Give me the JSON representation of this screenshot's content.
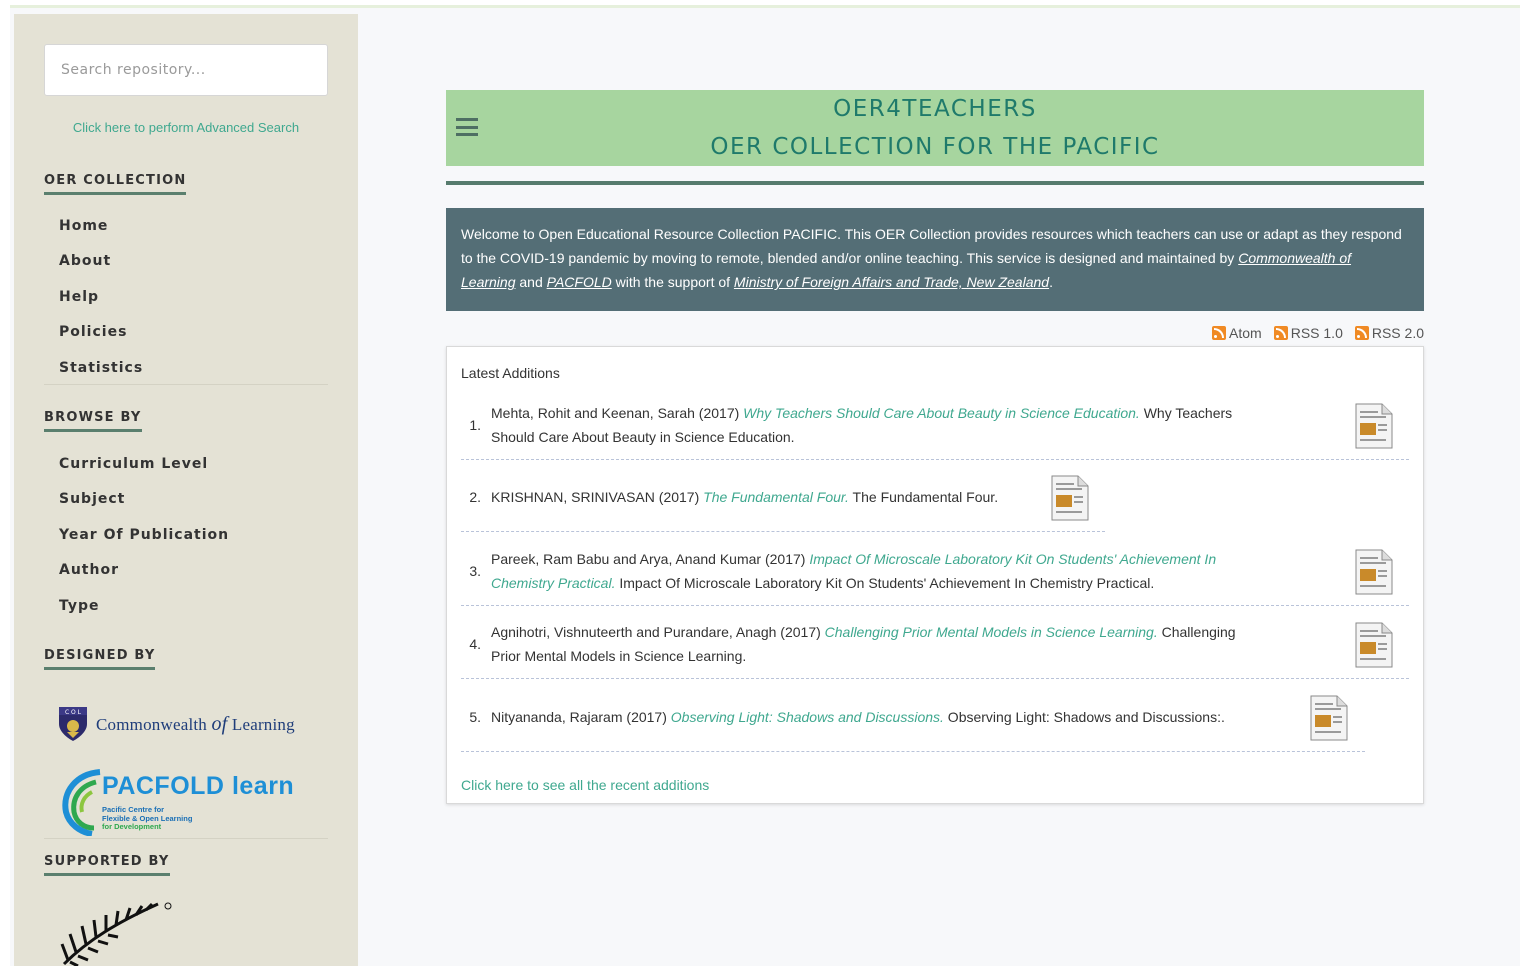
{
  "sidebar": {
    "search_placeholder": "Search repository...",
    "advanced_search_link": "Click here to perform Advanced Search",
    "sections": [
      {
        "heading": "OER COLLECTION",
        "items": [
          "Home",
          "About",
          "Help",
          "Policies",
          "Statistics"
        ]
      },
      {
        "heading": "BROWSE BY",
        "items": [
          "Curriculum Level",
          "Subject",
          "Year Of Publication",
          "Author",
          "Type"
        ]
      },
      {
        "heading": "DESIGNED BY"
      },
      {
        "heading": "SUPPORTED BY"
      }
    ],
    "logos": {
      "col_prefix": "Commonwealth ",
      "col_of": "of",
      "col_suffix": " Learning",
      "pacfold_main": "PACFOLD",
      "pacfold_learn": "learn",
      "pacfold_sub1": "Pacific Centre for",
      "pacfold_sub2": "Flexible & Open Learning",
      "pacfold_sub3": "for Development"
    }
  },
  "banner": {
    "title_line1": "OER4TEACHERS",
    "title_line2": "OER COLLECTION FOR THE PACIFIC"
  },
  "welcome": {
    "text_before": "Welcome to Open Educational Resource Collection PACIFIC. This OER Collection provides resources which teachers can use or adapt as they respond to the COVID-19 pandemic by moving to remote, blended and/or online teaching. This service is designed and maintained by ",
    "link_col": "Commonwealth of Learning",
    "and": " and ",
    "link_pacfold": "PACFOLD",
    "with_support": " with the support of ",
    "link_mfat": "Ministry of Foreign Affairs and Trade, New Zealand",
    "period": "."
  },
  "feeds": [
    "Atom",
    "RSS 1.0",
    "RSS 2.0"
  ],
  "latest": {
    "heading": "Latest Additions",
    "items": [
      {
        "num": "1.",
        "authors_before": "Mehta, Rohit",
        "and": " and ",
        "authors_after": "Keenan, Sarah",
        "year": " (2017) ",
        "title": "Why Teachers Should Care About Beauty in Science Education.",
        "desc_line1": " Why Teachers",
        "desc_line2": "Should Care About Beauty in Science Education."
      },
      {
        "num": "2.",
        "authors_before": "KRISHNAN, SRINIVASAN",
        "year": " (2017) ",
        "title": "The Fundamental Four.",
        "desc_line1": " The Fundamental Four."
      },
      {
        "num": "3.",
        "authors_before": "Pareek, Ram Babu",
        "and": " and ",
        "authors_after": "Arya, Anand Kumar",
        "year": " (2017) ",
        "title_line1": "Impact Of Microscale Laboratory Kit On Students' Achievement In",
        "title_line2": "Chemistry Practical.",
        "desc_line2": " Impact Of Microscale Laboratory Kit On Students' Achievement In Chemistry Practical."
      },
      {
        "num": "4.",
        "authors_before": "Agnihotri, Vishnuteerth",
        "and": " and ",
        "authors_after": "Purandare, Anagh",
        "year": " (2017) ",
        "title": "Challenging Prior Mental Models in Science Learning.",
        "desc_line1": " Challenging",
        "desc_line2": "Prior Mental Models in Science Learning."
      },
      {
        "num": "5.",
        "authors_before": "Nityananda, Rajaram",
        "year": " (2017) ",
        "title": "Observing Light: Shadows and Discussions.",
        "desc_line1": " Observing Light: Shadows and Discussions:."
      }
    ],
    "see_all": "Click here to see all the recent additions"
  },
  "colors": {
    "sidebar_bg": "#e4e2d5",
    "banner_bg": "#a7d59f",
    "welcome_bg": "#546e76",
    "link": "#3fa88f"
  }
}
